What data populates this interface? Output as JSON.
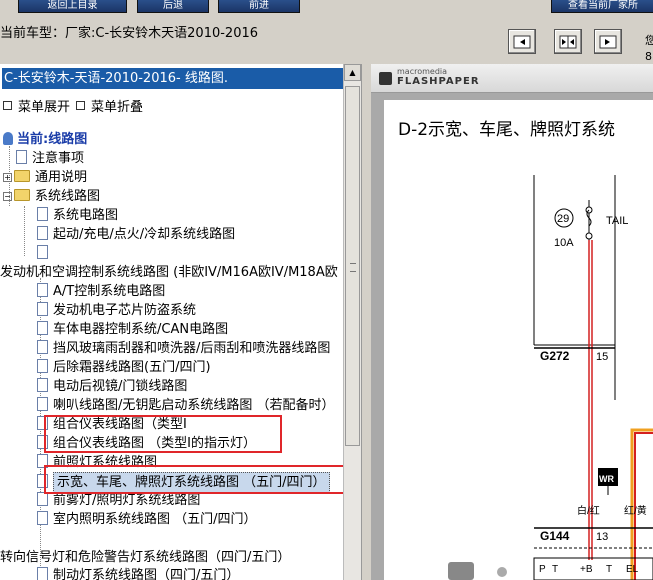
{
  "header": {
    "current_model": "当前车型：厂家:C-长安铃木天语2010-2016",
    "top_buttons": [
      "返回上目录",
      "后退",
      "前进",
      "查看当前厂家所"
    ],
    "edge_glyphs": [
      "您",
      "8"
    ]
  },
  "tree": {
    "title": "C-长安铃木-天语-2010-2016- 线路图.",
    "expand_all": "菜单展开",
    "collapse_all": "菜单折叠",
    "current_label": "当前:线路图",
    "items": [
      "注意事项",
      "通用说明",
      "系统线路图",
      "系统电路图",
      "起动/充电/点火/冷却系统线路图",
      "",
      "发动机和空调控制系统线路图 (非欧IV/M16A欧IV/M18A欧",
      "A/T控制系统电路图",
      "发动机电子芯片防盗系统",
      "车体电器控制系统/CAN电路图",
      "挡风玻璃雨刮器和喷洗器/后雨刮和喷洗器线路图",
      "后除霜器线路图(五门/四门)",
      "电动后视镜/门锁线路图",
      "喇叭线路图/无钥匙启动系统线路图 （若配备时）",
      "组合仪表线路图（类型Ⅰ",
      "组合仪表线路图 （类型Ⅰ的指示灯）",
      "前照灯系统线路图",
      "示宽、车尾、牌照灯系统线路图 （五门/四门）",
      "前雾灯/照明灯系统线路图",
      "室内照明系统线路图 （五门/四门）",
      "转向信号灯和危险警告灯系统线路图（四门/五门）",
      "制动灯系统线路图（四门/五门）"
    ]
  },
  "viewer": {
    "brand_small": "macromedia",
    "brand_big": "FLASHPAPER",
    "page_title": "D-2示宽、车尾、牌照灯系统",
    "fuse_number": "29",
    "fuse_label": "TAIL",
    "fuse_amp": "10A",
    "ground_g272": "G272",
    "pin_15": "15",
    "ground_g144": "G144",
    "pin_13": "13",
    "wire_white_red": "白/红",
    "wire_red_yellow": "红/黄",
    "wr_label": "WR",
    "connector_labels": [
      "P",
      "T",
      "+B",
      "T",
      "EL"
    ]
  },
  "colors": {
    "title_bar": "#1a5ca8",
    "highlight_box": "#e0262a",
    "selected_bg": "#c8d8ec",
    "wire_red": "#d42020",
    "wire_orange": "#f0a020"
  }
}
